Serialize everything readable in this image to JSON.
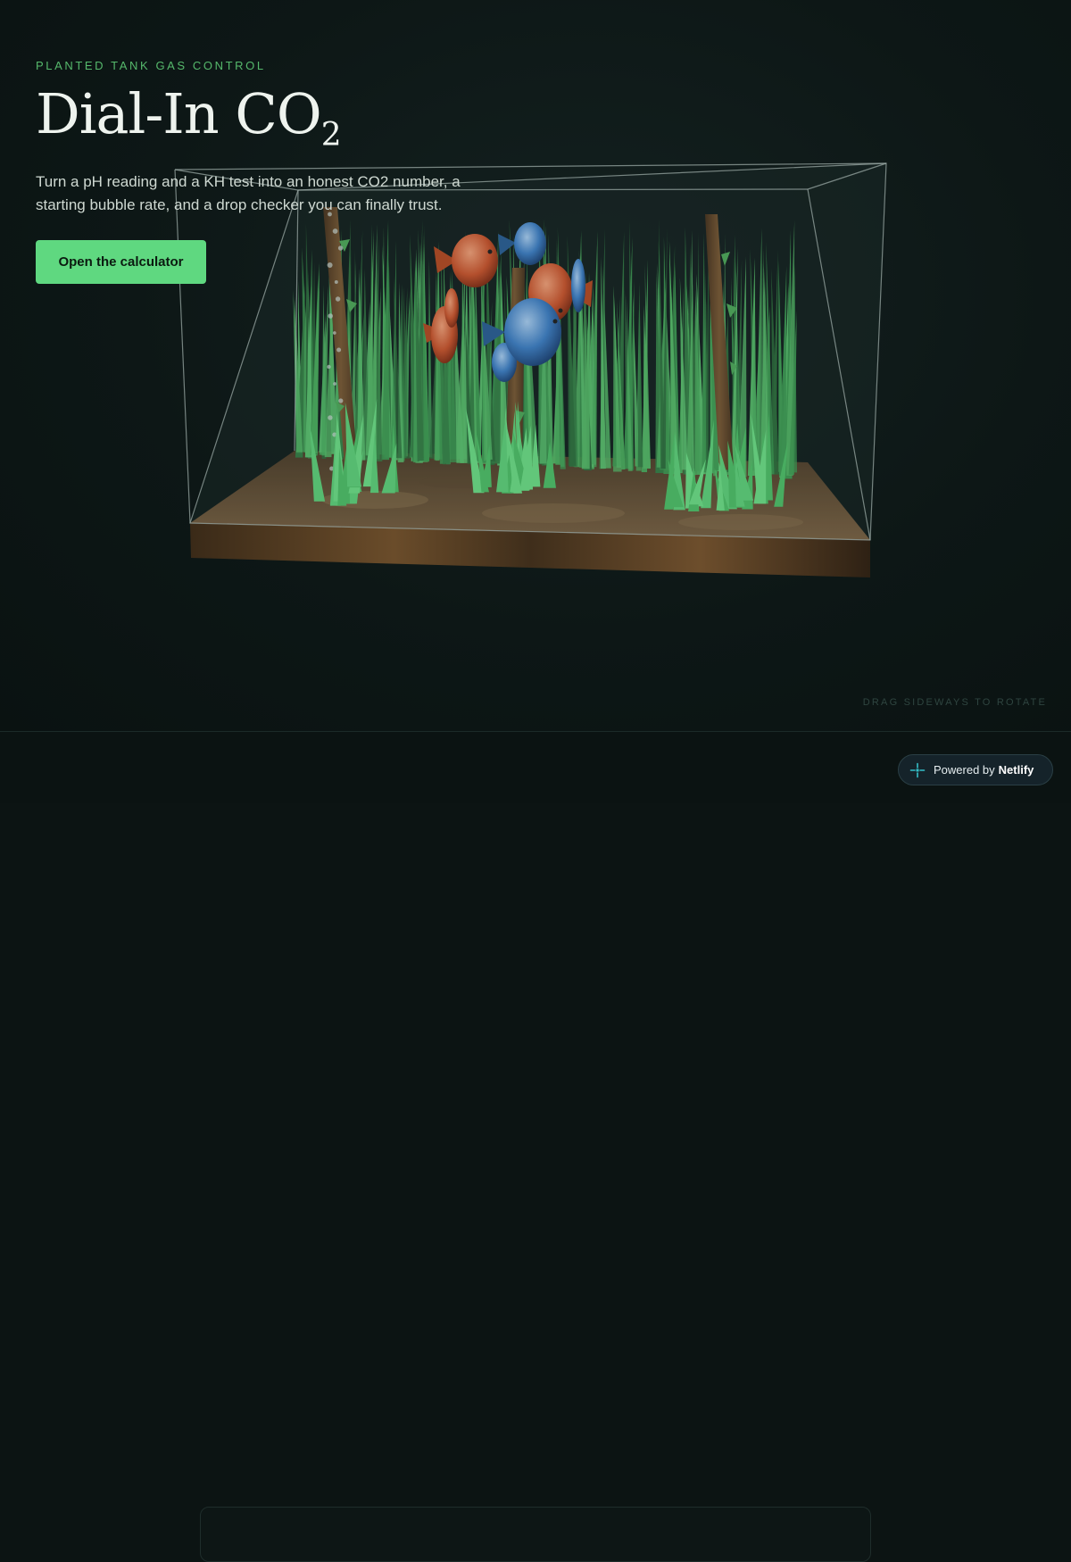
{
  "hero": {
    "eyebrow": "PLANTED TANK GAS CONTROL",
    "title_main": "Dial-In CO",
    "title_subscript": "2",
    "description": "Turn a pH reading and a KH test into an honest CO2 number, a starting bubble rate, and a drop checker you can finally trust.",
    "cta_label": "Open the calculator",
    "rotate_hint": "DRAG SIDEWAYS TO ROTATE"
  },
  "badge": {
    "prefix": "Powered by",
    "brand": "Netlify",
    "icon": "netlify-icon"
  },
  "colors": {
    "background": "#0c1413",
    "accent": "#5fd880",
    "eyebrow": "#56b96c",
    "title": "#eef3ee",
    "body_text": "#cfd9d2",
    "hint": "#2f4540"
  },
  "scene": {
    "object": "aquarium-tank",
    "contents": [
      "grass-plants",
      "driftwood",
      "fish",
      "co2-bubbles",
      "substrate"
    ]
  }
}
